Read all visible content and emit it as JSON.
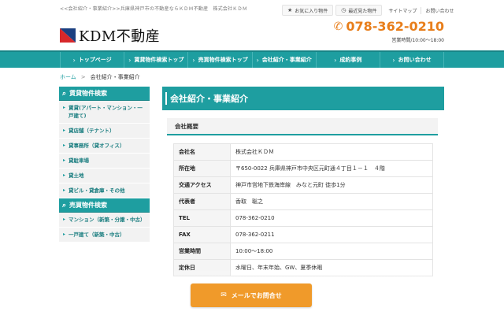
{
  "header": {
    "breadcrumb_top": "<<会社紹介・事業紹介>>兵庫県神戸市の不動産ならＫＤＭ不動産　株式会社ＫＤＭ",
    "favorites": "お気に入り物件",
    "recent": "最近見た物件",
    "sitemap": "サイトマップ",
    "contact": "お問い合わせ",
    "logo_text": "KDM不動産",
    "phone": "078-362-0210",
    "hours": "営業時間/10:00～18:00"
  },
  "nav": [
    "トップページ",
    "賃貸物件検索トップ",
    "売買物件検索トップ",
    "会社紹介・事業紹介",
    "成約事例",
    "お問い合わせ"
  ],
  "crumb": {
    "home": "ホーム",
    "sep": ">",
    "current": "会社紹介・事業紹介"
  },
  "sidebar": {
    "rent_head": "賃貸物件検索",
    "rent_items": [
      "賃貸(アパート・マンション・一戸建て)",
      "貸店舗（テナント）",
      "貸事務所（貸オフィス）",
      "貸駐車場",
      "貸土地",
      "貸ビル・貸倉庫・その他"
    ],
    "sale_head": "売買物件検索",
    "sale_items": [
      "マンション（新築・分譲・中古）",
      "一戸建て（新築・中古）"
    ]
  },
  "main": {
    "title": "会社紹介・事業紹介",
    "section": "会社概要",
    "rows": [
      {
        "k": "会社名",
        "v": "株式会社ＫＤＭ"
      },
      {
        "k": "所在地",
        "v": "〒650-0022 兵庫県神戸市中央区元町通４丁目１－１　４階"
      },
      {
        "k": "交通アクセス",
        "v": "神戸市営地下鉄海岸線　みなと元町 徒歩1分"
      },
      {
        "k": "代表者",
        "v": "香取　聡之"
      },
      {
        "k": "TEL",
        "v": "078-362-0210"
      },
      {
        "k": "FAX",
        "v": "078-362-0211"
      },
      {
        "k": "営業時間",
        "v": "10:00～18:00"
      },
      {
        "k": "定休日",
        "v": "水曜日、年末年始、GW、夏季休暇"
      }
    ]
  },
  "cta": {
    "mail": "メールでお問合せ"
  }
}
